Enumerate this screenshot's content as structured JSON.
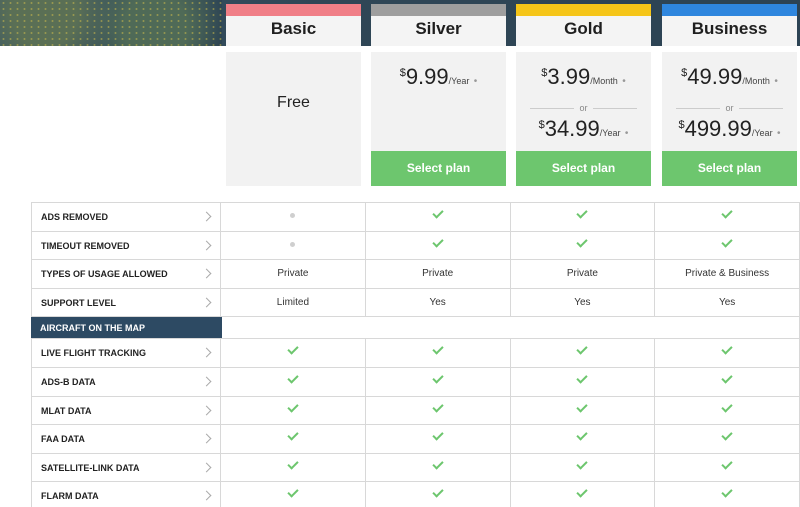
{
  "plans": [
    {
      "name": "Basic",
      "stripe_color": "#f07f87",
      "free_label": "Free"
    },
    {
      "name": "Silver",
      "stripe_color": "#9e9e9e",
      "prices": [
        {
          "currency": "$",
          "amount": "9.99",
          "period": "/Year",
          "mark": "•"
        }
      ],
      "cta": "Select plan"
    },
    {
      "name": "Gold",
      "stripe_color": "#f5c518",
      "prices": [
        {
          "currency": "$",
          "amount": "3.99",
          "period": "/Month",
          "mark": "•"
        },
        {
          "currency": "$",
          "amount": "34.99",
          "period": "/Year",
          "mark": "•"
        }
      ],
      "or_label": "or",
      "cta": "Select plan"
    },
    {
      "name": "Business",
      "stripe_color": "#2e86de",
      "prices": [
        {
          "currency": "$",
          "amount": "49.99",
          "period": "/Month",
          "mark": "•"
        },
        {
          "currency": "$",
          "amount": "499.99",
          "period": "/Year",
          "mark": "•"
        }
      ],
      "or_label": "or",
      "cta": "Select plan"
    }
  ],
  "colors": {
    "accent_green": "#6dc66e",
    "section_blue": "#2d4a63"
  },
  "rows": [
    {
      "label": "ADS REMOVED",
      "values": [
        "dot",
        "check",
        "check",
        "check"
      ]
    },
    {
      "label": "TIMEOUT REMOVED",
      "values": [
        "dot",
        "check",
        "check",
        "check"
      ]
    },
    {
      "label": "TYPES OF USAGE ALLOWED",
      "values": [
        "Private",
        "Private",
        "Private",
        "Private & Business"
      ]
    },
    {
      "label": "SUPPORT LEVEL",
      "values": [
        "Limited",
        "Yes",
        "Yes",
        "Yes"
      ]
    }
  ],
  "section": {
    "label": "AIRCRAFT ON THE MAP"
  },
  "section_rows": [
    {
      "label": "LIVE FLIGHT TRACKING",
      "values": [
        "check",
        "check",
        "check",
        "check"
      ]
    },
    {
      "label": "ADS-B DATA",
      "values": [
        "check",
        "check",
        "check",
        "check"
      ]
    },
    {
      "label": "MLAT DATA",
      "values": [
        "check",
        "check",
        "check",
        "check"
      ]
    },
    {
      "label": "FAA DATA",
      "values": [
        "check",
        "check",
        "check",
        "check"
      ]
    },
    {
      "label": "SATELLITE-LINK DATA",
      "values": [
        "check",
        "check",
        "check",
        "check"
      ]
    },
    {
      "label": "FLARM DATA",
      "values": [
        "check",
        "check",
        "check",
        "check"
      ]
    }
  ]
}
